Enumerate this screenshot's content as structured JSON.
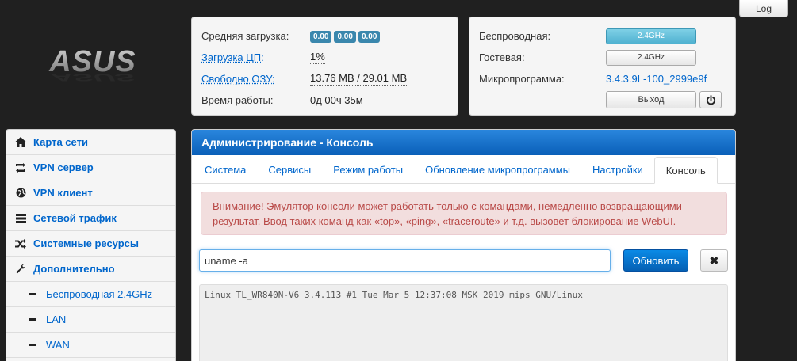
{
  "topbar": {
    "log_label": "Log"
  },
  "logo": {
    "text": "ASUS"
  },
  "status": {
    "load_label": "Средняя загрузка:",
    "load_values": [
      "0.00",
      "0.00",
      "0.00"
    ],
    "cpu_label": "Загрузка ЦП:",
    "cpu_value": "1%",
    "ram_label": "Свободно ОЗУ:",
    "ram_value": "13.76 MB / 29.01 MB",
    "uptime_label": "Время работы:",
    "uptime_value": "0д 00ч 35м"
  },
  "wifi": {
    "wireless_label": "Беспроводная:",
    "wireless_value": "2.4GHz",
    "guest_label": "Гостевая:",
    "guest_value": "2.4GHz",
    "firmware_label": "Микропрограмма:",
    "firmware_value": "3.4.3.9L-100_2999e9f",
    "exit_label": "Выход"
  },
  "sidebar": {
    "items": [
      {
        "label": "Карта сети",
        "icon": "home-icon"
      },
      {
        "label": "VPN сервер",
        "icon": "retweet-icon"
      },
      {
        "label": "VPN клиент",
        "icon": "globe-icon"
      },
      {
        "label": "Сетевой трафик",
        "icon": "list-icon"
      },
      {
        "label": "Системные ресурсы",
        "icon": "random-icon"
      },
      {
        "label": "Дополнительно",
        "icon": "wrench-icon"
      }
    ],
    "subitems": [
      {
        "label": "Беспроводная 2.4GHz"
      },
      {
        "label": "LAN"
      },
      {
        "label": "WAN"
      }
    ]
  },
  "main": {
    "title": "Администрирование - Консоль",
    "tabs": [
      {
        "label": "Система"
      },
      {
        "label": "Сервисы"
      },
      {
        "label": "Режим работы"
      },
      {
        "label": "Обновление микропрограммы"
      },
      {
        "label": "Настройки"
      },
      {
        "label": "Консоль"
      }
    ],
    "alert_line1": "Внимание! Эмулятор консоли может работать только с командами, немедленно возвращающими",
    "alert_line2": "результат. Ввод таких команд как «top», «ping», «traceroute» и т.д. вызовет блокирование WebUI.",
    "command_value": "uname -a",
    "refresh_label": "Обновить",
    "clear_label": "✖",
    "console_output": "Linux TL_WR840N-V6 3.4.113 #1 Tue Mar 5 12:37:08 MSK 2019 mips GNU/Linux"
  }
}
